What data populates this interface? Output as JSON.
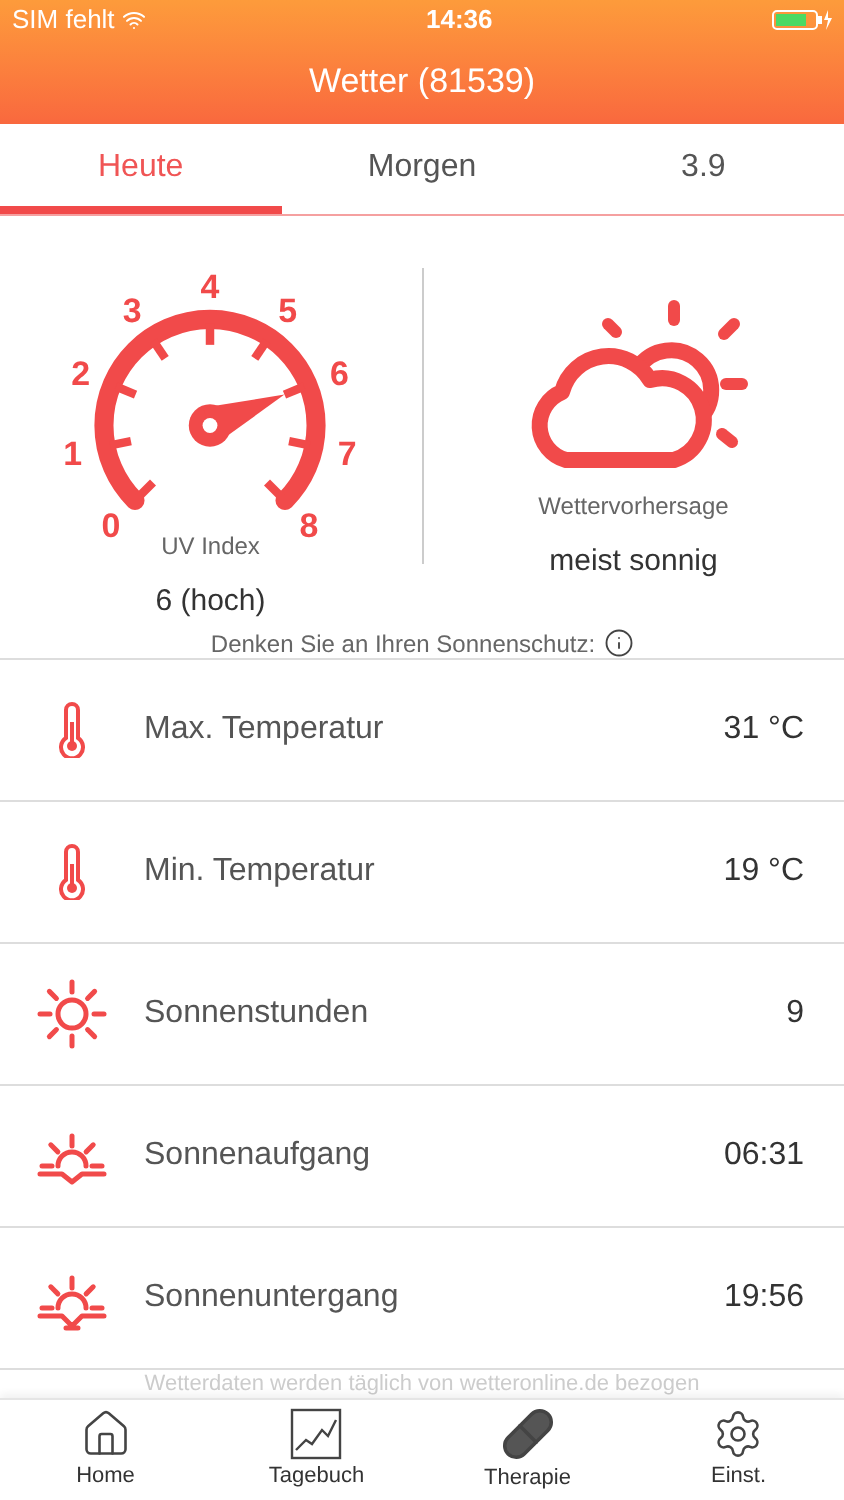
{
  "status_bar": {
    "carrier": "SIM fehlt",
    "time": "14:36"
  },
  "header": {
    "title": "Wetter (81539)"
  },
  "tabs": [
    {
      "label": "Heute",
      "selected": true
    },
    {
      "label": "Morgen",
      "selected": false
    },
    {
      "label": "3.9",
      "selected": false
    }
  ],
  "uv": {
    "scale_labels": [
      "0",
      "1",
      "2",
      "3",
      "4",
      "5",
      "6",
      "7",
      "8"
    ],
    "label": "UV Index",
    "value": "6 (hoch)"
  },
  "forecast": {
    "label": "Wettervorhersage",
    "value": "meist sonnig"
  },
  "sun_hint": "Denken Sie an Ihren Sonnenschutz:",
  "rows": [
    {
      "kind": "thermometer",
      "label": "Max. Temperatur",
      "value": "31 °C"
    },
    {
      "kind": "thermometer",
      "label": "Min. Temperatur",
      "value": "19 °C"
    },
    {
      "kind": "sun",
      "label": "Sonnenstunden",
      "value": "9"
    },
    {
      "kind": "sunrise",
      "label": "Sonnenaufgang",
      "value": "06:31"
    },
    {
      "kind": "sunset",
      "label": "Sonnenuntergang",
      "value": "19:56"
    }
  ],
  "source_note": "Wetterdaten werden täglich von wetteronline.de bezogen",
  "tab_bar": [
    {
      "kind": "home",
      "label": "Home"
    },
    {
      "kind": "chart",
      "label": "Tagebuch"
    },
    {
      "kind": "pill",
      "label": "Therapie"
    },
    {
      "kind": "settings",
      "label": "Einst."
    }
  ]
}
